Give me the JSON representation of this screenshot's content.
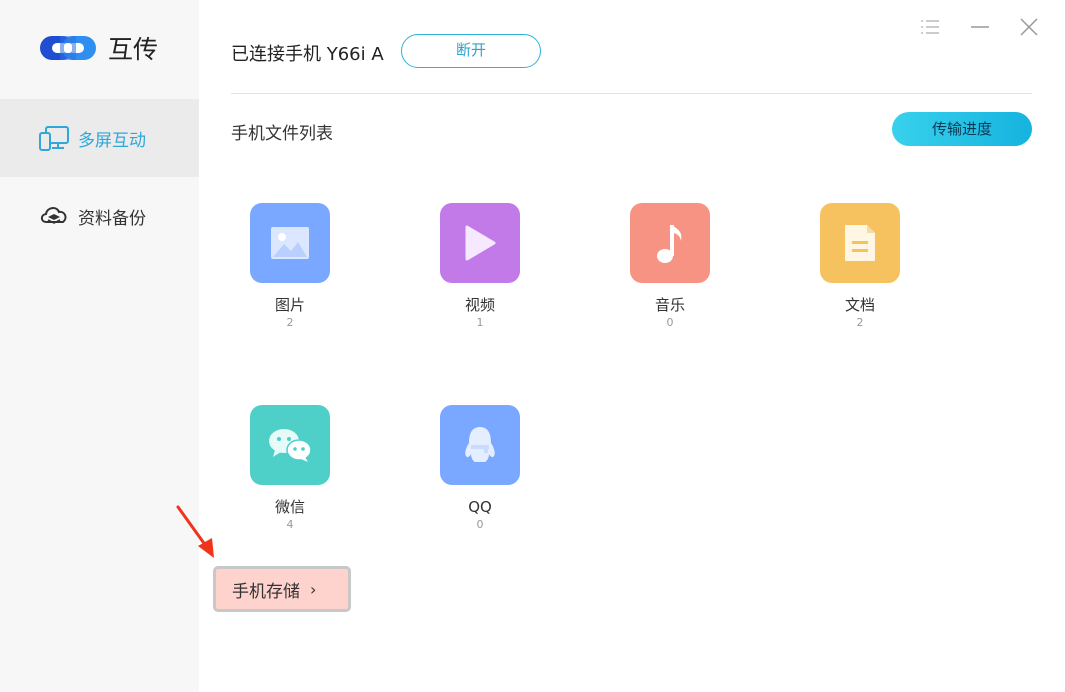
{
  "app": {
    "title": "互传"
  },
  "sidebar": {
    "items": [
      {
        "label": "多屏互动",
        "icon": "screens-icon",
        "active": true
      },
      {
        "label": "资料备份",
        "icon": "cloud-layers-icon",
        "active": false
      }
    ]
  },
  "header": {
    "connected_text": "已连接手机 Y66i A",
    "disconnect_label": "断开"
  },
  "main": {
    "section_title": "手机文件列表",
    "progress_label": "传输进度",
    "categories": [
      {
        "label": "图片",
        "count": "2",
        "icon": "image-icon",
        "color": "#7aa7ff"
      },
      {
        "label": "视频",
        "count": "1",
        "icon": "play-icon",
        "color": "#c17ae8"
      },
      {
        "label": "音乐",
        "count": "0",
        "icon": "music-note-icon",
        "color": "#f79382"
      },
      {
        "label": "文档",
        "count": "2",
        "icon": "document-icon",
        "color": "#f6c260"
      },
      {
        "label": "微信",
        "count": "4",
        "icon": "wechat-icon",
        "color": "#4ed0c9"
      },
      {
        "label": "QQ",
        "count": "0",
        "icon": "qq-penguin-icon",
        "color": "#7aa7ff"
      }
    ],
    "storage_label": "手机存储",
    "storage_chevron": "›"
  },
  "colors": {
    "accent": "#2fa7d9",
    "highlight": "#ffd3cd",
    "annotation_arrow": "#f0341c"
  }
}
